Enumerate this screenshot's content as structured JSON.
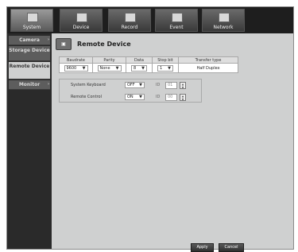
{
  "tabs": [
    {
      "label": "System",
      "icon": "system-icon",
      "active": true
    },
    {
      "label": "Device",
      "icon": "device-icon"
    },
    {
      "label": "Record",
      "icon": "record-icon"
    },
    {
      "label": "Event",
      "icon": "event-icon"
    },
    {
      "label": "Network",
      "icon": "network-icon"
    }
  ],
  "sidebar": {
    "items": [
      {
        "label": "Camera"
      },
      {
        "label": "Storage Device"
      },
      {
        "label": "Remote Device",
        "active": true
      },
      {
        "label": "Monitor"
      }
    ]
  },
  "panel": {
    "icon_text": "▣",
    "title": "Remote Device",
    "table": {
      "headers": [
        "Baudrate",
        "Parity",
        "Data",
        "Stop bit",
        "Transfer type"
      ],
      "values": {
        "baudrate": "9600",
        "parity": "None",
        "data": "8",
        "stop_bit": "1",
        "transfer_type": "Half Duplex"
      }
    },
    "options": [
      {
        "label": "System Keyboard",
        "value": "OFF",
        "id_label": "ID",
        "id_value": "01"
      },
      {
        "label": "Remote Control",
        "value": "ON",
        "id_label": "ID",
        "id_value": "00"
      }
    ]
  },
  "buttons": {
    "apply": "Apply",
    "cancel": "Cancel"
  },
  "colors": {
    "background": "#cfd0d0",
    "topbar": "#1e1e1e",
    "sidebar": "#2a2a2a",
    "button": "#3a3a3a"
  }
}
